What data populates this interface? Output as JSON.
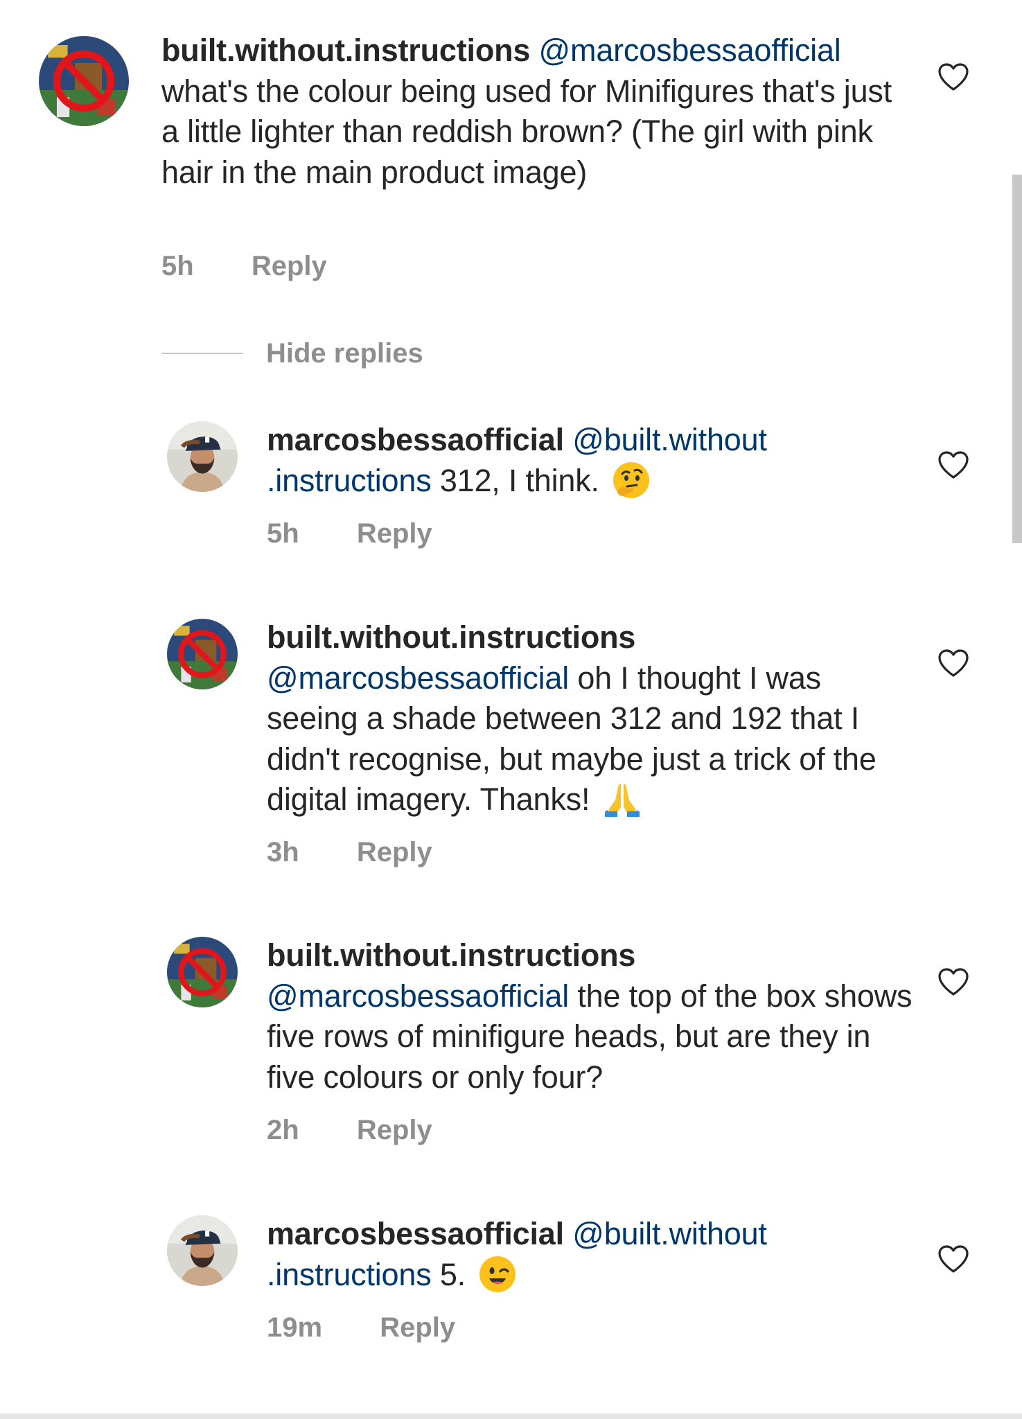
{
  "colors": {
    "text": "#262626",
    "mention": "#00376b",
    "meta": "#8e8e8e",
    "divider": "#c7c7c7"
  },
  "thread": {
    "parent": {
      "username": "built.without.instructions",
      "mention": "@marcosbessaofficial",
      "text": "what's the colour being used for Minifigures that's just a little lighter than reddish brown? (The girl with pink hair in the main product image)",
      "time": "5h",
      "reply_label": "Reply",
      "avatar_icon": "no-symbol-avatar",
      "like_icon": "heart-outline-icon"
    },
    "hide_replies_label": "Hide replies",
    "replies": [
      {
        "username": "marcosbessaofficial",
        "mention_line1": "@built.without",
        "mention_line2": ".instructions",
        "text": "312, I think.",
        "emoji": "thinking-face-emoji",
        "time": "5h",
        "reply_label": "Reply",
        "avatar_icon": "profile-photo-avatar"
      },
      {
        "username": "built.without.instructions",
        "mention": "@marcosbessaofficial",
        "text": "oh I thought I was seeing a shade between 312 and 192 that I didn't recognise, but maybe just a trick of the digital imagery. Thanks!",
        "emoji": "folded-hands-emoji",
        "time": "3h",
        "reply_label": "Reply",
        "avatar_icon": "no-symbol-avatar"
      },
      {
        "username": "built.without.instructions",
        "mention": "@marcosbessaofficial",
        "text": "the top of the box shows five rows of minifigure heads, but are they in five colours or only four?",
        "time": "2h",
        "reply_label": "Reply",
        "avatar_icon": "no-symbol-avatar"
      },
      {
        "username": "marcosbessaofficial",
        "mention_line1": "@built.without",
        "mention_line2": ".instructions",
        "text": "5.",
        "emoji": "winking-face-emoji",
        "time": "19m",
        "reply_label": "Reply",
        "avatar_icon": "profile-photo-avatar"
      }
    ]
  }
}
